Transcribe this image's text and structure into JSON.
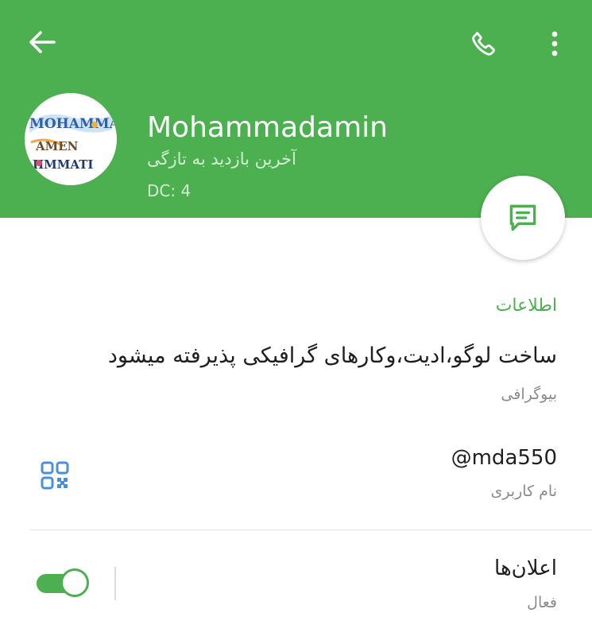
{
  "colors": {
    "header_bg": "#4caf50",
    "accent": "#4caf50",
    "primary_text": "#1f1f1f",
    "secondary_text": "#8a8a8a",
    "qr_icon": "#4a90d9"
  },
  "toolbar": {
    "back_icon": "arrow-left-icon",
    "call_icon": "phone-icon",
    "menu_icon": "more-vertical-icon"
  },
  "profile": {
    "avatar_text": {
      "line1": "MOHAMMAD",
      "line2": "AMEN",
      "line3": "HMMATI"
    },
    "name": "Mohammadamin",
    "status": "آخرین بازدید به تازگی",
    "dc": "DC: 4"
  },
  "fab": {
    "icon": "message-icon"
  },
  "info": {
    "title": "اطلاعات",
    "bio": "ساخت لوگو،ادیت،وکارهای گرافیکی پذیرفته میشود",
    "bio_label": "بیوگرافی",
    "username": "@mda550",
    "username_label": "نام کاربری",
    "qr_icon": "qr-code-icon"
  },
  "notifications": {
    "label": "اعلان‌ها",
    "status": "فعال",
    "enabled": true
  }
}
